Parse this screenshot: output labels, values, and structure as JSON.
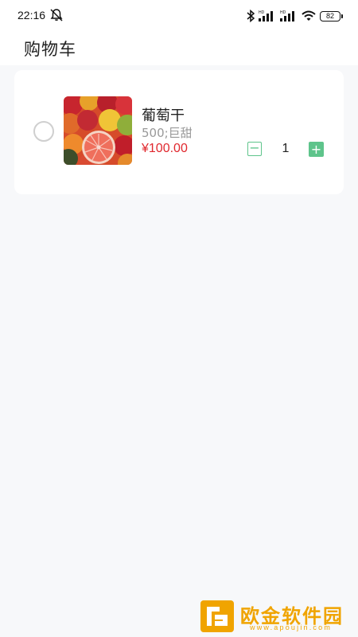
{
  "status_bar": {
    "time": "22:16",
    "battery": "82",
    "icons": [
      "notification-muted-icon",
      "bluetooth-icon",
      "hd-signal-icon",
      "hd-signal-icon",
      "wifi-icon",
      "battery-icon"
    ]
  },
  "header": {
    "title": "购物车"
  },
  "cart": {
    "items": [
      {
        "image_icon": "fruit-image",
        "name": "葡萄干",
        "spec": "500;巨甜",
        "price": "¥100.00",
        "quantity": "1",
        "minus_label": "−",
        "plus_label": "+",
        "selected": false
      }
    ]
  },
  "watermark": {
    "text": "欧金软件园",
    "url": "www.apoujin.com"
  },
  "colors": {
    "accent": "#5ec48b",
    "price": "#e0282e",
    "background": "#f7f8fa",
    "watermark": "#f0a400"
  }
}
